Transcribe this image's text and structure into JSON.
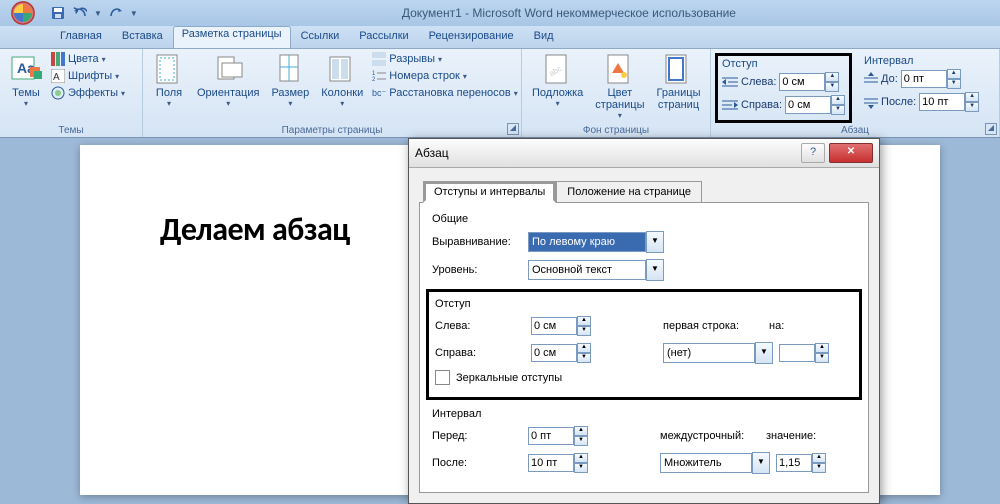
{
  "title": "Документ1 - Microsoft Word некоммерческое использование",
  "tabs": [
    "Главная",
    "Вставка",
    "Разметка страницы",
    "Ссылки",
    "Рассылки",
    "Рецензирование",
    "Вид"
  ],
  "active_tab": 2,
  "ribbon": {
    "themes": {
      "label": "Темы",
      "btn": "Темы",
      "colors": "Цвета",
      "fonts": "Шрифты",
      "effects": "Эффекты"
    },
    "page_setup": {
      "label": "Параметры страницы",
      "margins": "Поля",
      "orientation": "Ориентация",
      "size": "Размер",
      "columns": "Колонки",
      "breaks": "Разрывы",
      "line_numbers": "Номера строк",
      "hyphenation": "Расстановка переносов"
    },
    "page_bg": {
      "label": "Фон страницы",
      "watermark": "Подложка",
      "page_color": "Цвет\nстраницы",
      "borders": "Границы\nстраниц"
    },
    "paragraph": {
      "label": "Абзац",
      "indent": "Отступ",
      "spacing": "Интервал",
      "left": "Слева:",
      "right": "Справа:",
      "before": "До:",
      "after": "После:",
      "left_val": "0 см",
      "right_val": "0 см",
      "before_val": "0 пт",
      "after_val": "10 пт"
    }
  },
  "doc_text": "Делаем абзац",
  "dialog": {
    "title": "Абзац",
    "tabs": [
      "Отступы и интервалы",
      "Положение на странице"
    ],
    "general": {
      "label": "Общие",
      "align_label": "Выравнивание:",
      "align_val": "По левому краю",
      "level_label": "Уровень:",
      "level_val": "Основной текст"
    },
    "indent": {
      "label": "Отступ",
      "left_label": "Слева:",
      "left_val": "0 см",
      "right_label": "Справа:",
      "right_val": "0 см",
      "first_label": "первая строка:",
      "first_val": "(нет)",
      "by_label": "на:",
      "mirror": "Зеркальные отступы"
    },
    "spacing": {
      "label": "Интервал",
      "before_label": "Перед:",
      "before_val": "0 пт",
      "after_label": "После:",
      "after_val": "10 пт",
      "line_label": "междустрочный:",
      "line_val": "Множитель",
      "at_label": "значение:",
      "at_val": "1,15"
    }
  }
}
